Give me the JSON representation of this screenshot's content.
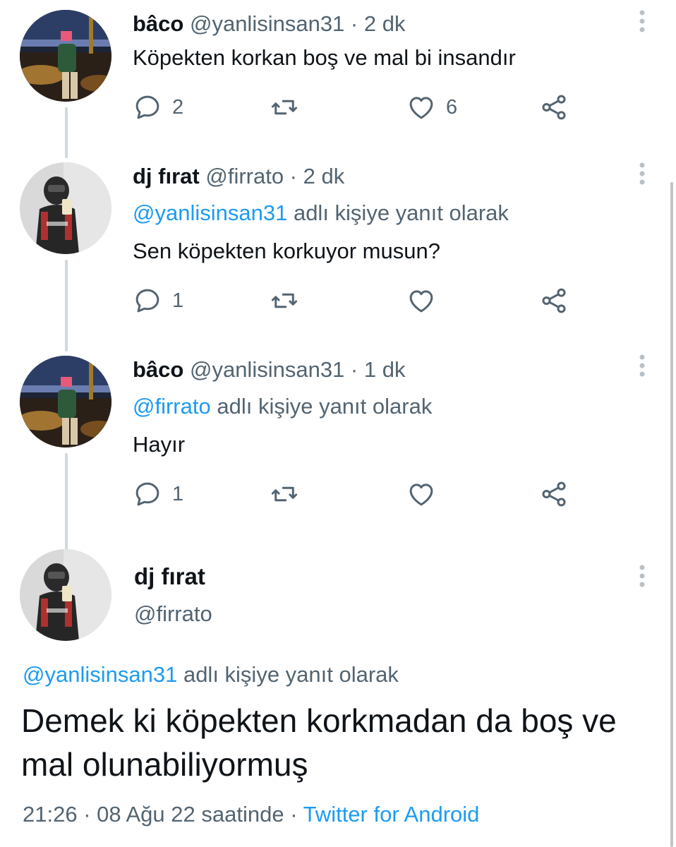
{
  "tweets": [
    {
      "display_name": "bâco",
      "handle_meta": "@yanlisinsan31 · 2 dk",
      "reply_to_handle": "",
      "reply_to_suffix": "",
      "text": "Köpekten korkan boş ve mal bi insandır",
      "replies": "2",
      "likes": "6"
    },
    {
      "display_name": "dj fırat",
      "handle_meta": "@firrato · 2 dk",
      "reply_to_handle": "@yanlisinsan31",
      "reply_to_suffix": "adlı kişiye yanıt olarak",
      "text": "Sen köpekten korkuyor musun?",
      "replies": "1",
      "likes": ""
    },
    {
      "display_name": "bâco",
      "handle_meta": "@yanlisinsan31 · 1 dk",
      "reply_to_handle": "@firrato",
      "reply_to_suffix": "adlı kişiye yanıt olarak",
      "text": "Hayır",
      "replies": "1",
      "likes": ""
    }
  ],
  "main_tweet": {
    "display_name": "dj fırat",
    "handle": "@firrato",
    "reply_to_handle": "@yanlisinsan31",
    "reply_to_suffix": "adlı kişiye yanıt olarak",
    "text": "Demek ki köpekten korkmadan da boş ve mal olunabiliyormuş",
    "timestamp": "21:26 · 08 Ağu 22 saatinde ·",
    "source": "Twitter for Android"
  },
  "icons": {
    "reply": "reply-icon",
    "retweet": "retweet-icon",
    "like": "heart-icon",
    "share": "share-icon",
    "more": "more-vertical-icon"
  },
  "colors": {
    "accent": "#1d9bf0",
    "secondary_text": "#536471",
    "primary_text": "#0f1419",
    "thread_line": "#cfd9de"
  }
}
